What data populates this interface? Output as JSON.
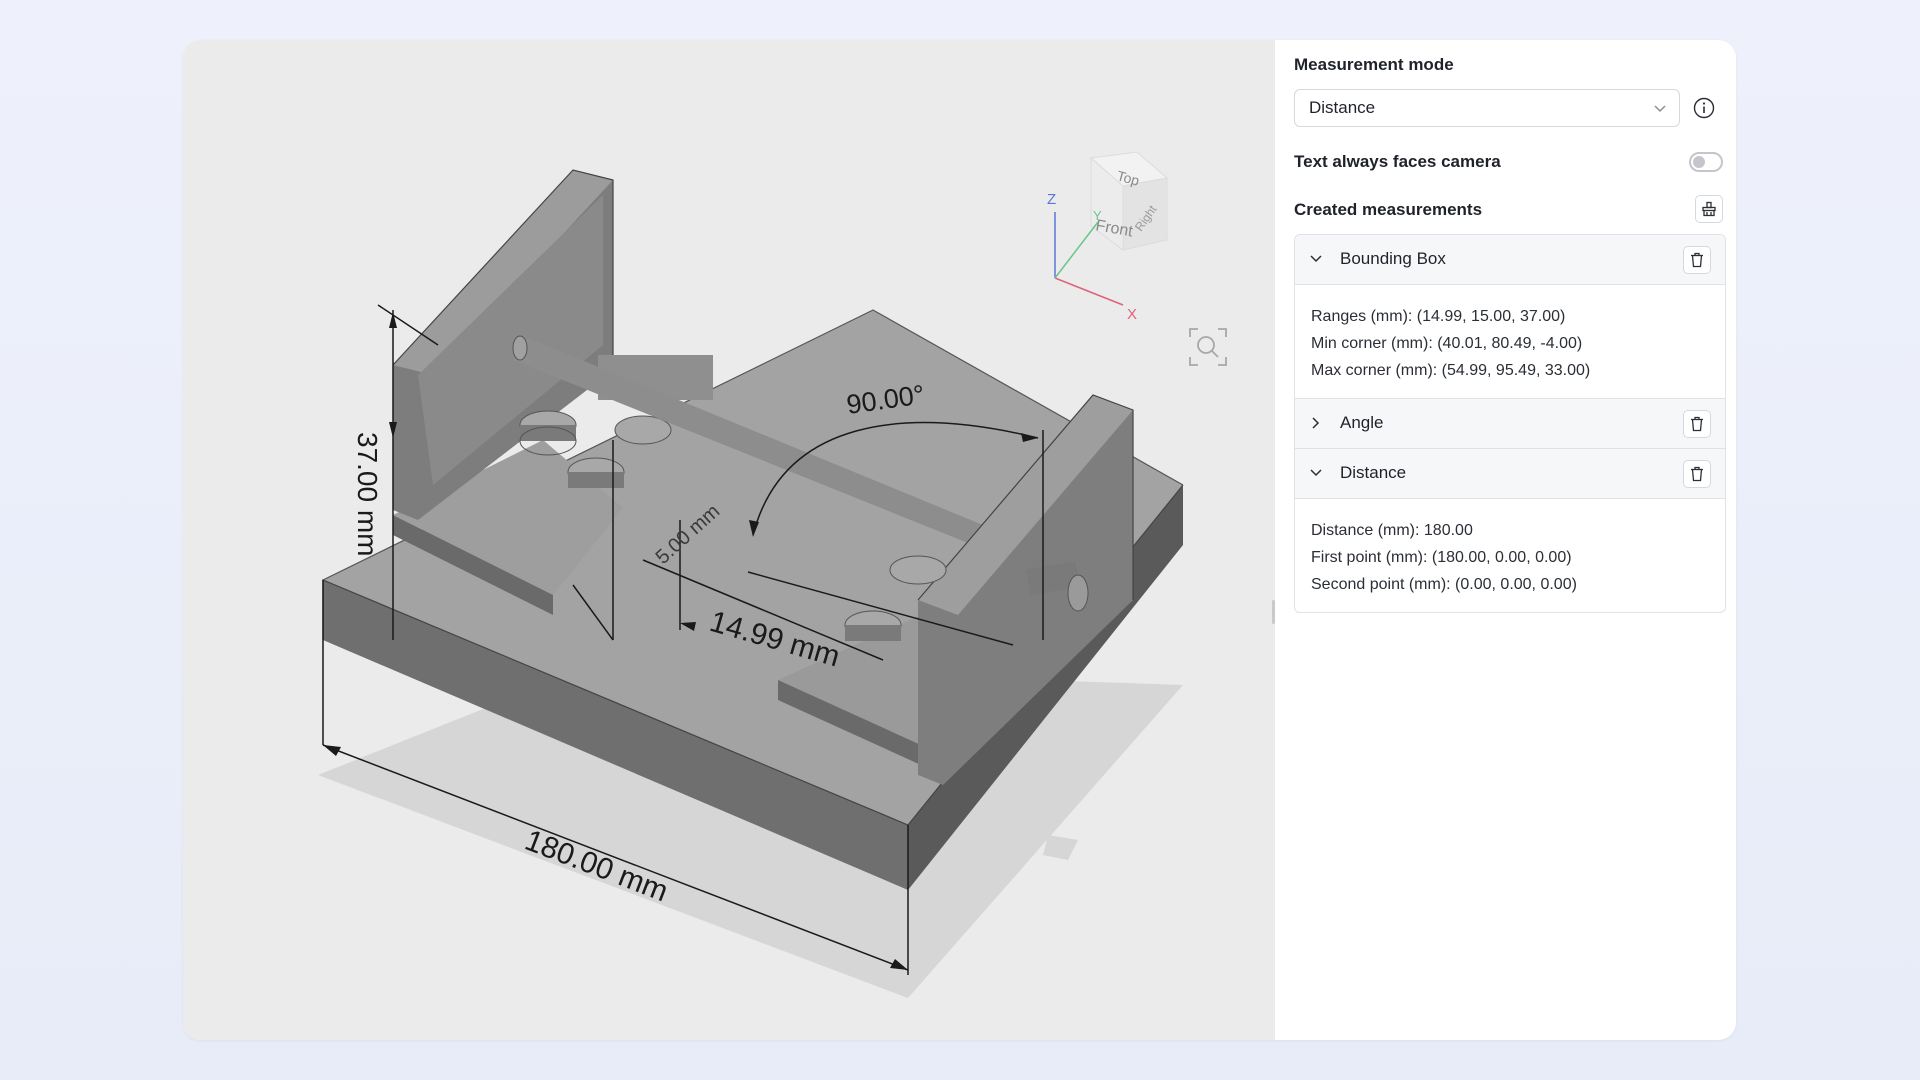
{
  "viewer": {
    "dimension_labels": {
      "overall_length": "180.00 mm",
      "height": "37.00 mm",
      "width": "14.99 mm",
      "slot": "5.00 mm",
      "angle": "90.00°"
    },
    "view_cube": {
      "top": "Top",
      "front": "Front",
      "right": "Right"
    },
    "axes": {
      "x": "X",
      "y": "Y",
      "z": "Z"
    }
  },
  "panel": {
    "measurement_mode_label": "Measurement mode",
    "measurement_mode_value": "Distance",
    "text_faces_camera_label": "Text always faces camera",
    "text_faces_camera_on": false,
    "created_measurements_label": "Created measurements",
    "measurements": [
      {
        "title": "Bounding Box",
        "expanded": true,
        "lines": [
          "Ranges (mm): (14.99, 15.00, 37.00)",
          "Min corner (mm): (40.01, 80.49, -4.00)",
          "Max corner (mm): (54.99, 95.49, 33.00)"
        ]
      },
      {
        "title": "Angle",
        "expanded": false,
        "lines": []
      },
      {
        "title": "Distance",
        "expanded": true,
        "lines": [
          "Distance (mm): 180.00",
          "First point (mm): (180.00, 0.00, 0.00)",
          "Second point (mm): (0.00, 0.00, 0.00)"
        ]
      }
    ]
  },
  "colors": {
    "viewport_bg": "#ebebeb",
    "model_top": "#9a9a9a",
    "model_side_dark": "#6c6c6c",
    "shadow": "#d6d6d6",
    "axis_x": "#e0627a",
    "axis_y": "#68c68a",
    "axis_z": "#5b76d8"
  }
}
